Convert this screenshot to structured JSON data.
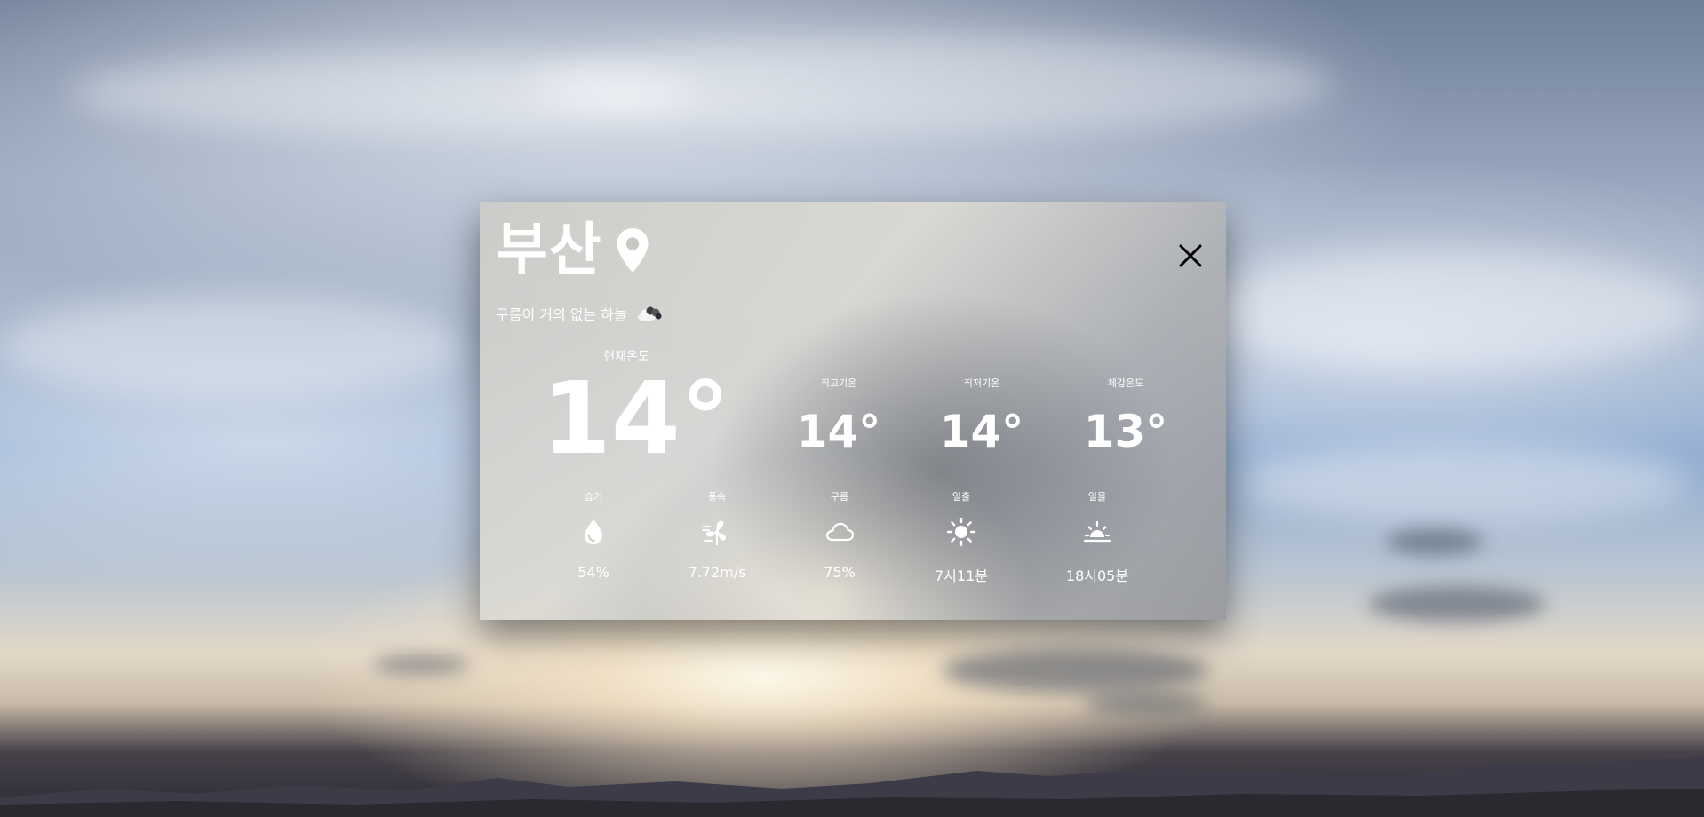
{
  "card": {
    "city": "부산",
    "description": "구름이 거의 없는 하늘",
    "current_label": "현재온도",
    "current_temp": "14°"
  },
  "stats": [
    {
      "label": "최고기온",
      "value": "14°"
    },
    {
      "label": "최저기온",
      "value": "14°"
    },
    {
      "label": "체감온도",
      "value": "13°"
    }
  ],
  "details": [
    {
      "label": "습기",
      "value": "54%",
      "icon": "droplet-icon"
    },
    {
      "label": "풍속",
      "value": "7.72m/s",
      "icon": "wind-fan-icon"
    },
    {
      "label": "구름",
      "value": "75%",
      "icon": "cloud-icon"
    },
    {
      "label": "일출",
      "value": "7시11분",
      "icon": "sunrise-icon"
    },
    {
      "label": "일몰",
      "value": "18시05분",
      "icon": "sunset-icon"
    }
  ],
  "icons": {
    "location": "map-pin-icon",
    "weather": "few-clouds-icon",
    "close": "close-icon"
  }
}
